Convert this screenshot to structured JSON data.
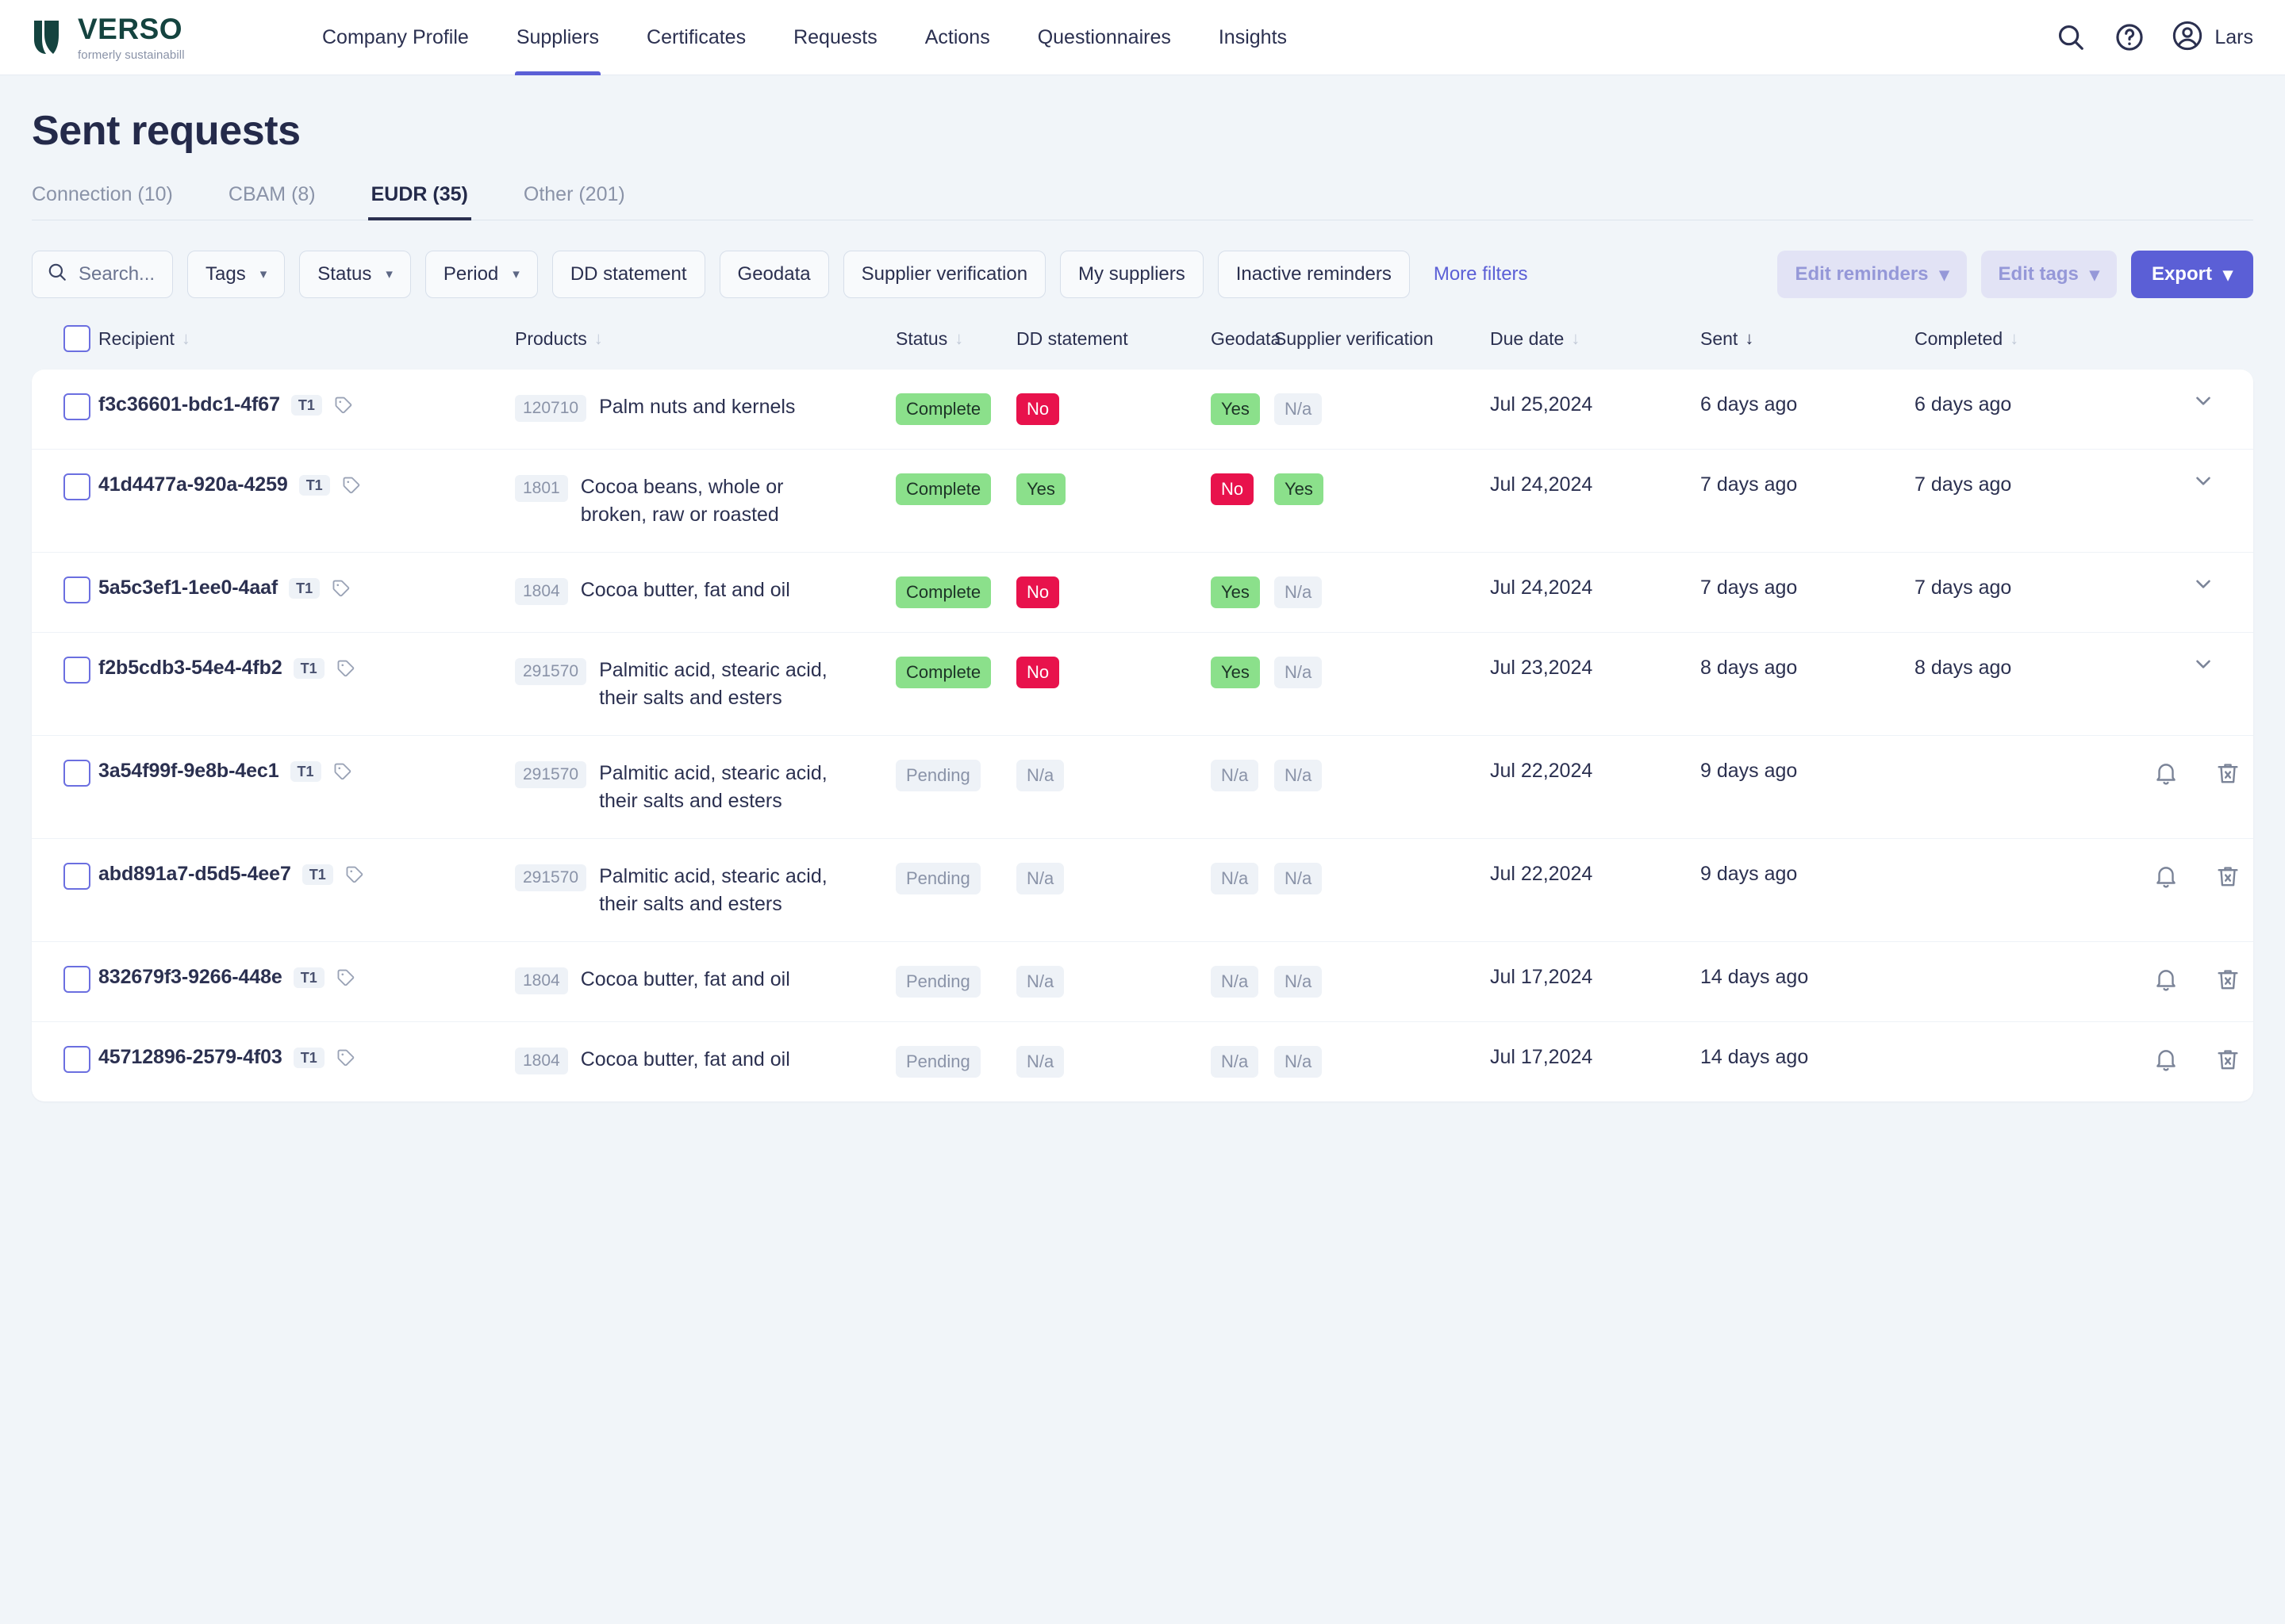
{
  "brand": {
    "name": "VERSO",
    "tagline": "formerly sustainabill",
    "accent": "#5b5fd6",
    "logo_color": "#14433f"
  },
  "nav": {
    "items": [
      {
        "label": "Company Profile",
        "active": false
      },
      {
        "label": "Suppliers",
        "active": true
      },
      {
        "label": "Certificates",
        "active": false
      },
      {
        "label": "Requests",
        "active": false
      },
      {
        "label": "Actions",
        "active": false
      },
      {
        "label": "Questionnaires",
        "active": false
      },
      {
        "label": "Insights",
        "active": false
      }
    ],
    "user_name": "Lars"
  },
  "header": {
    "title": "Sent requests"
  },
  "subtabs": [
    {
      "label": "Connection (10)",
      "active": false
    },
    {
      "label": "CBAM (8)",
      "active": false
    },
    {
      "label": "EUDR (35)",
      "active": true
    },
    {
      "label": "Other (201)",
      "active": false
    }
  ],
  "toolbar": {
    "search_placeholder": "Search...",
    "filters": [
      {
        "label": "Tags",
        "caret": true
      },
      {
        "label": "Status",
        "caret": true
      },
      {
        "label": "Period",
        "caret": true
      },
      {
        "label": "DD statement",
        "caret": false
      },
      {
        "label": "Geodata",
        "caret": false
      },
      {
        "label": "Supplier verification",
        "caret": false
      },
      {
        "label": "My suppliers",
        "caret": false
      },
      {
        "label": "Inactive reminders",
        "caret": false
      }
    ],
    "more_filters_label": "More filters",
    "edit_reminders_label": "Edit reminders",
    "edit_tags_label": "Edit tags",
    "export_label": "Export"
  },
  "table": {
    "columns": [
      {
        "key": "recipient",
        "label": "Recipient",
        "sortable": true,
        "sort_active": false
      },
      {
        "key": "products",
        "label": "Products",
        "sortable": true,
        "sort_active": false
      },
      {
        "key": "status",
        "label": "Status",
        "sortable": true,
        "sort_active": false
      },
      {
        "key": "dd_statement",
        "label": "DD statement",
        "sortable": false,
        "sort_active": false
      },
      {
        "key": "geodata",
        "label": "Geodata",
        "sortable": false,
        "sort_active": false
      },
      {
        "key": "supplier_verification",
        "label": "Supplier verification",
        "sortable": false,
        "sort_active": false
      },
      {
        "key": "due_date",
        "label": "Due date",
        "sortable": true,
        "sort_active": false
      },
      {
        "key": "sent",
        "label": "Sent",
        "sortable": true,
        "sort_active": true
      },
      {
        "key": "completed",
        "label": "Completed",
        "sortable": true,
        "sort_active": false
      }
    ],
    "rows": [
      {
        "recipient": "f3c36601-bdc1-4f67",
        "tier": "T1",
        "product_code": "120710",
        "product_name": "Palm nuts and kernels",
        "status": {
          "text": "Complete",
          "tone": "green"
        },
        "dd_statement": {
          "text": "No",
          "tone": "red"
        },
        "geodata": {
          "text": "Yes",
          "tone": "green"
        },
        "supplier_verification": {
          "text": "N/a",
          "tone": "gray"
        },
        "due_date": "Jul 25,2024",
        "sent": "6 days ago",
        "completed": "6 days ago",
        "actions": {
          "reminder": false,
          "delete": false,
          "expand": true
        }
      },
      {
        "recipient": "41d4477a-920a-4259",
        "tier": "T1",
        "product_code": "1801",
        "product_name": "Cocoa beans, whole or broken, raw or roasted",
        "status": {
          "text": "Complete",
          "tone": "green"
        },
        "dd_statement": {
          "text": "Yes",
          "tone": "green"
        },
        "geodata": {
          "text": "No",
          "tone": "red"
        },
        "supplier_verification": {
          "text": "Yes",
          "tone": "green"
        },
        "due_date": "Jul 24,2024",
        "sent": "7 days ago",
        "completed": "7 days ago",
        "actions": {
          "reminder": false,
          "delete": false,
          "expand": true
        }
      },
      {
        "recipient": "5a5c3ef1-1ee0-4aaf",
        "tier": "T1",
        "product_code": "1804",
        "product_name": "Cocoa butter, fat and oil",
        "status": {
          "text": "Complete",
          "tone": "green"
        },
        "dd_statement": {
          "text": "No",
          "tone": "red"
        },
        "geodata": {
          "text": "Yes",
          "tone": "green"
        },
        "supplier_verification": {
          "text": "N/a",
          "tone": "gray"
        },
        "due_date": "Jul 24,2024",
        "sent": "7 days ago",
        "completed": "7 days ago",
        "actions": {
          "reminder": false,
          "delete": false,
          "expand": true
        }
      },
      {
        "recipient": "f2b5cdb3-54e4-4fb2",
        "tier": "T1",
        "product_code": "291570",
        "product_name": "Palmitic acid, stearic acid, their salts and esters",
        "status": {
          "text": "Complete",
          "tone": "green"
        },
        "dd_statement": {
          "text": "No",
          "tone": "red"
        },
        "geodata": {
          "text": "Yes",
          "tone": "green"
        },
        "supplier_verification": {
          "text": "N/a",
          "tone": "gray"
        },
        "due_date": "Jul 23,2024",
        "sent": "8 days ago",
        "completed": "8 days ago",
        "actions": {
          "reminder": false,
          "delete": false,
          "expand": true
        }
      },
      {
        "recipient": "3a54f99f-9e8b-4ec1",
        "tier": "T1",
        "product_code": "291570",
        "product_name": "Palmitic acid, stearic acid, their salts and esters",
        "status": {
          "text": "Pending",
          "tone": "gray"
        },
        "dd_statement": {
          "text": "N/a",
          "tone": "gray"
        },
        "geodata": {
          "text": "N/a",
          "tone": "gray"
        },
        "supplier_verification": {
          "text": "N/a",
          "tone": "gray"
        },
        "due_date": "Jul 22,2024",
        "sent": "9 days ago",
        "completed": "",
        "actions": {
          "reminder": true,
          "delete": true,
          "expand": true
        }
      },
      {
        "recipient": "abd891a7-d5d5-4ee7",
        "tier": "T1",
        "product_code": "291570",
        "product_name": "Palmitic acid, stearic acid, their salts and esters",
        "status": {
          "text": "Pending",
          "tone": "gray"
        },
        "dd_statement": {
          "text": "N/a",
          "tone": "gray"
        },
        "geodata": {
          "text": "N/a",
          "tone": "gray"
        },
        "supplier_verification": {
          "text": "N/a",
          "tone": "gray"
        },
        "due_date": "Jul 22,2024",
        "sent": "9 days ago",
        "completed": "",
        "actions": {
          "reminder": true,
          "delete": true,
          "expand": true
        }
      },
      {
        "recipient": "832679f3-9266-448e",
        "tier": "T1",
        "product_code": "1804",
        "product_name": "Cocoa butter, fat and oil",
        "status": {
          "text": "Pending",
          "tone": "gray"
        },
        "dd_statement": {
          "text": "N/a",
          "tone": "gray"
        },
        "geodata": {
          "text": "N/a",
          "tone": "gray"
        },
        "supplier_verification": {
          "text": "N/a",
          "tone": "gray"
        },
        "due_date": "Jul 17,2024",
        "sent": "14 days ago",
        "completed": "",
        "actions": {
          "reminder": true,
          "delete": true,
          "expand": true
        }
      },
      {
        "recipient": "45712896-2579-4f03",
        "tier": "T1",
        "product_code": "1804",
        "product_name": "Cocoa butter, fat and oil",
        "status": {
          "text": "Pending",
          "tone": "gray"
        },
        "dd_statement": {
          "text": "N/a",
          "tone": "gray"
        },
        "geodata": {
          "text": "N/a",
          "tone": "gray"
        },
        "supplier_verification": {
          "text": "N/a",
          "tone": "gray"
        },
        "due_date": "Jul 17,2024",
        "sent": "14 days ago",
        "completed": "",
        "actions": {
          "reminder": true,
          "delete": true,
          "expand": true
        }
      }
    ]
  },
  "icons": {
    "search": "search-icon",
    "help": "help-circle-icon",
    "avatar": "user-circle-icon",
    "tag": "tag-icon",
    "bell": "bell-icon",
    "trash": "trash-x-icon",
    "chevron": "chevron-down-icon"
  }
}
